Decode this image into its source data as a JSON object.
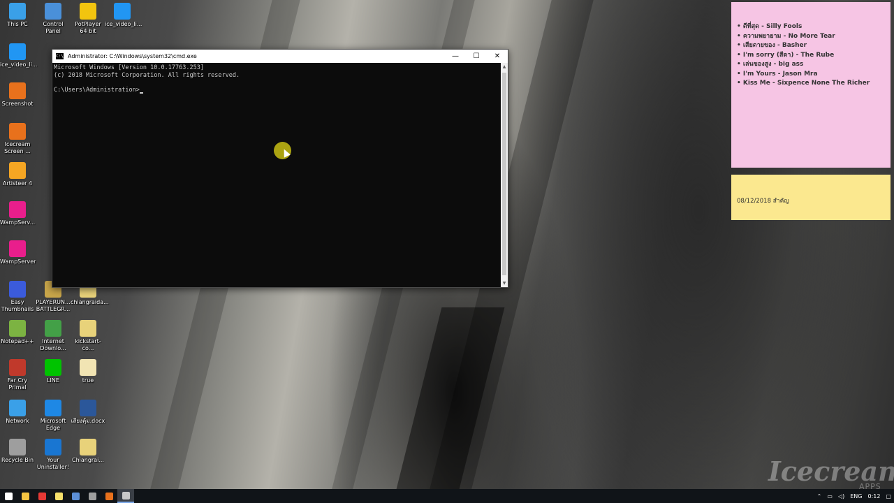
{
  "desktop_icons": [
    {
      "label": "This PC",
      "color": "#3aa0e8"
    },
    {
      "label": "Control Panel",
      "color": "#4a90d9"
    },
    {
      "label": "PotPlayer 64 bit",
      "color": "#f2c40f"
    },
    {
      "label": "ice_video_li...",
      "color": "#2196f3"
    },
    {
      "label": "ice_video_li...",
      "color": "#2196f3"
    },
    {
      "label": "Screenshot",
      "color": "#e8711c"
    },
    {
      "label": "Icecream Screen ...",
      "color": "#e8711c"
    },
    {
      "label": "Artisteer 4",
      "color": "#f5a623"
    },
    {
      "label": "WampServ...",
      "color": "#e91e8c"
    },
    {
      "label": "WampServer",
      "color": "#e91e8c"
    },
    {
      "label": "Easy Thumbnails",
      "color": "#3b5bdb"
    },
    {
      "label": "PLAYERUN... BATTLEGR...",
      "color": "#c9a64a"
    },
    {
      "label": "chiangraida...",
      "color": "#e8d27a"
    },
    {
      "label": "Notepad++",
      "color": "#7cb342"
    },
    {
      "label": "Internet Downlo...",
      "color": "#43a047"
    },
    {
      "label": "kickstart-co...",
      "color": "#e8d27a"
    },
    {
      "label": "Far Cry Primal",
      "color": "#c0392b"
    },
    {
      "label": "LINE",
      "color": "#00c300"
    },
    {
      "label": "true",
      "color": "#f1e4b3"
    },
    {
      "label": "Network",
      "color": "#3aa0e8"
    },
    {
      "label": "Microsoft Edge",
      "color": "#1e88e5"
    },
    {
      "label": "เสียงคุ้ม.docx",
      "color": "#2b579a"
    },
    {
      "label": "Recycle Bin",
      "color": "#9e9e9e"
    },
    {
      "label": "Your Uninstaller!",
      "color": "#1976d2"
    },
    {
      "label": "Chiangrai...",
      "color": "#e8d27a"
    }
  ],
  "cmd": {
    "title": "Administrator: C:\\Windows\\system32\\cmd.exe",
    "line1": "Microsoft Windows [Version 10.0.17763.253]",
    "line2": "(c) 2018 Microsoft Corporation. All rights reserved.",
    "prompt": "C:\\Users\\Administration>",
    "minimize": "—",
    "maximize": "☐",
    "close": "✕"
  },
  "notes": {
    "songs": [
      "ดีที่สุด - Silly Fools",
      "ความพยายาม - No More Tear",
      "เสียดายของ - Basher",
      "I'm sorry (สีดา) - The Rube",
      "เล่นของสูง - big ass",
      "I'm Yours  - Jason Mra",
      "Kiss Me - Sixpence None The Richer"
    ],
    "yellow_text": "08/12/2018  สำคัญ"
  },
  "watermark": {
    "brand": "Icecream",
    "sub": "APPS"
  },
  "taskbar": {
    "items": [
      {
        "name": "start",
        "color": "#ffffff"
      },
      {
        "name": "file-explorer",
        "color": "#f5c542"
      },
      {
        "name": "chrome",
        "color": "#e53935"
      },
      {
        "name": "sticky-notes",
        "color": "#f5e06b"
      },
      {
        "name": "task-app",
        "color": "#5c8fd6"
      },
      {
        "name": "app",
        "color": "#9e9e9e"
      },
      {
        "name": "icecream",
        "color": "#e8711c"
      },
      {
        "name": "cmd",
        "color": "#c8c8c8"
      }
    ],
    "lang": "ENG",
    "time": "0:12",
    "caret_up": "⌃"
  }
}
